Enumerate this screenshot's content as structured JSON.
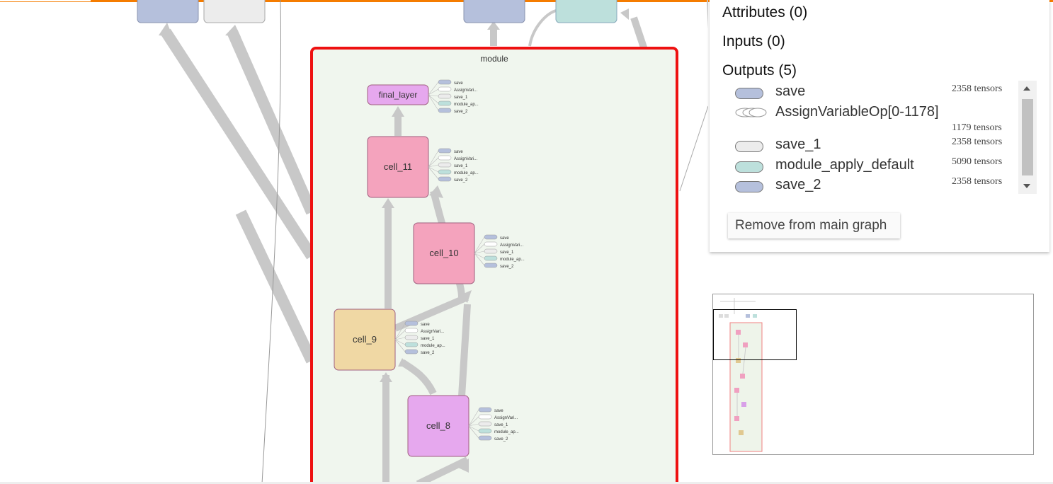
{
  "graph": {
    "module_label": "module",
    "nodes": [
      {
        "id": "final_layer",
        "label": "final_layer",
        "fill": "#e6a8ee"
      },
      {
        "id": "cell_11",
        "label": "cell_11",
        "fill": "#f4a3bd"
      },
      {
        "id": "cell_10",
        "label": "cell_10",
        "fill": "#f4a3bd"
      },
      {
        "id": "cell_9",
        "label": "cell_9",
        "fill": "#f0d8a4"
      },
      {
        "id": "cell_8",
        "label": "cell_8",
        "fill": "#e6a8ee"
      }
    ],
    "mini_outputs": [
      "save",
      "AssignVari...",
      "save_1",
      "module_ap...",
      "save_2"
    ]
  },
  "panel": {
    "attributes": "Attributes (0)",
    "inputs": "Inputs (0)",
    "outputs_heading": "Outputs (5)",
    "outputs": [
      {
        "name": "save",
        "count": "2358 tensors",
        "fill": "#b5c0dc"
      },
      {
        "name": "AssignVariableOp[0-1178]",
        "count": "1179 tensors",
        "fill": "none"
      },
      {
        "name": "save_1",
        "count": "2358 tensors",
        "fill": "#ececec"
      },
      {
        "name": "module_apply_default",
        "count": "5090 tensors",
        "fill": "#bde0dc"
      },
      {
        "name": "save_2",
        "count": "2358 tensors",
        "fill": "#b5c0dc"
      }
    ],
    "remove_button": "Remove from main graph"
  },
  "colors": {
    "accent": "#f57c00",
    "selection": "#e11",
    "module_bg": "#f0f6ee"
  }
}
